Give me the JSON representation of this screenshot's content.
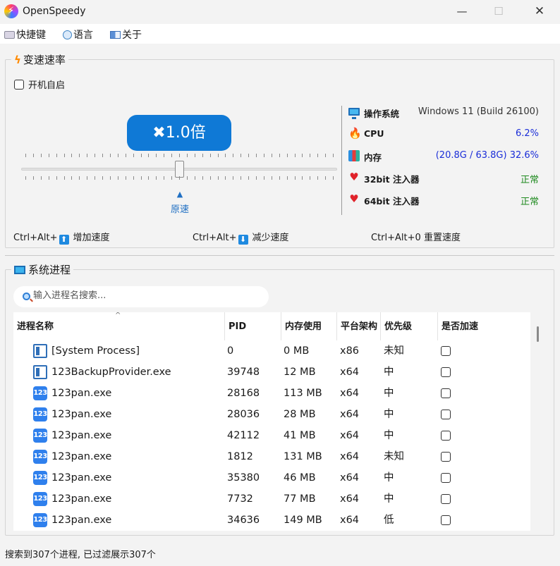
{
  "window": {
    "title": "OpenSpeedy",
    "controls": {
      "minimize": "—",
      "maximize": "☐",
      "close": "✕"
    }
  },
  "menu": {
    "items": [
      {
        "label": "快捷键",
        "icon": "keyboard-icon"
      },
      {
        "label": "语言",
        "icon": "globe-icon"
      },
      {
        "label": "关于",
        "icon": "book-icon"
      }
    ]
  },
  "speed": {
    "group_title": "变速速率",
    "autostart_label": "开机自启",
    "autostart_checked": false,
    "multiplier": "✖1.0倍",
    "slider_value": 1.0,
    "origin_label": "原速",
    "origin_arrow": "▲"
  },
  "system_info": [
    {
      "icon": "monitor-icon",
      "label": "操作系统",
      "value": "Windows 11 (Build 26100)",
      "tone": "plain"
    },
    {
      "icon": "flame-icon",
      "label": "CPU",
      "value": "6.2%",
      "tone": "blue"
    },
    {
      "icon": "memory-icon",
      "label": "内存",
      "value": "(20.8G / 63.8G) 32.6%",
      "tone": "blue"
    },
    {
      "icon": "heart-icon",
      "label": "32bit 注入器",
      "value": "正常",
      "tone": "green"
    },
    {
      "icon": "heart-icon",
      "label": "64bit 注入器",
      "value": "正常",
      "tone": "green"
    }
  ],
  "hotkeys": [
    {
      "keys": "Ctrl+Alt+",
      "arrow": "⬆",
      "action": "增加速度"
    },
    {
      "keys": "Ctrl+Alt+",
      "arrow": "⬇",
      "action": "减少速度"
    },
    {
      "keys": "Ctrl+Alt+0",
      "arrow": "",
      "action": "重置速度"
    }
  ],
  "process": {
    "group_title": "系统进程",
    "search_placeholder": "输入进程名搜索...",
    "columns": [
      "进程名称",
      "PID",
      "内存使用",
      "平台架构",
      "优先级",
      "是否加速"
    ],
    "sort_indicator": "^",
    "rows": [
      {
        "icon": "system-process-icon",
        "name": "[System Process]",
        "pid": "0",
        "memory": "0 MB",
        "arch": "x86",
        "priority": "未知",
        "accelerated": false
      },
      {
        "icon": "system-process-icon",
        "name": "123BackupProvider.exe",
        "pid": "39748",
        "memory": "12 MB",
        "arch": "x64",
        "priority": "中",
        "accelerated": false
      },
      {
        "icon": "123pan-icon",
        "name": "123pan.exe",
        "pid": "28168",
        "memory": "113 MB",
        "arch": "x64",
        "priority": "中",
        "accelerated": false
      },
      {
        "icon": "123pan-icon",
        "name": "123pan.exe",
        "pid": "28036",
        "memory": "28 MB",
        "arch": "x64",
        "priority": "中",
        "accelerated": false
      },
      {
        "icon": "123pan-icon",
        "name": "123pan.exe",
        "pid": "42112",
        "memory": "41 MB",
        "arch": "x64",
        "priority": "中",
        "accelerated": false
      },
      {
        "icon": "123pan-icon",
        "name": "123pan.exe",
        "pid": "1812",
        "memory": "131 MB",
        "arch": "x64",
        "priority": "未知",
        "accelerated": false
      },
      {
        "icon": "123pan-icon",
        "name": "123pan.exe",
        "pid": "35380",
        "memory": "46 MB",
        "arch": "x64",
        "priority": "中",
        "accelerated": false
      },
      {
        "icon": "123pan-icon",
        "name": "123pan.exe",
        "pid": "7732",
        "memory": "77 MB",
        "arch": "x64",
        "priority": "中",
        "accelerated": false
      },
      {
        "icon": "123pan-icon",
        "name": "123pan.exe",
        "pid": "34636",
        "memory": "149 MB",
        "arch": "x64",
        "priority": "低",
        "accelerated": false
      }
    ],
    "pan_icon_text": "123"
  },
  "status": {
    "text": "搜索到307个进程, 已过滤展示307个"
  },
  "colors": {
    "accent": "#0f79d6",
    "value_blue": "#1a2dd8",
    "value_green": "#1f8a1f"
  }
}
